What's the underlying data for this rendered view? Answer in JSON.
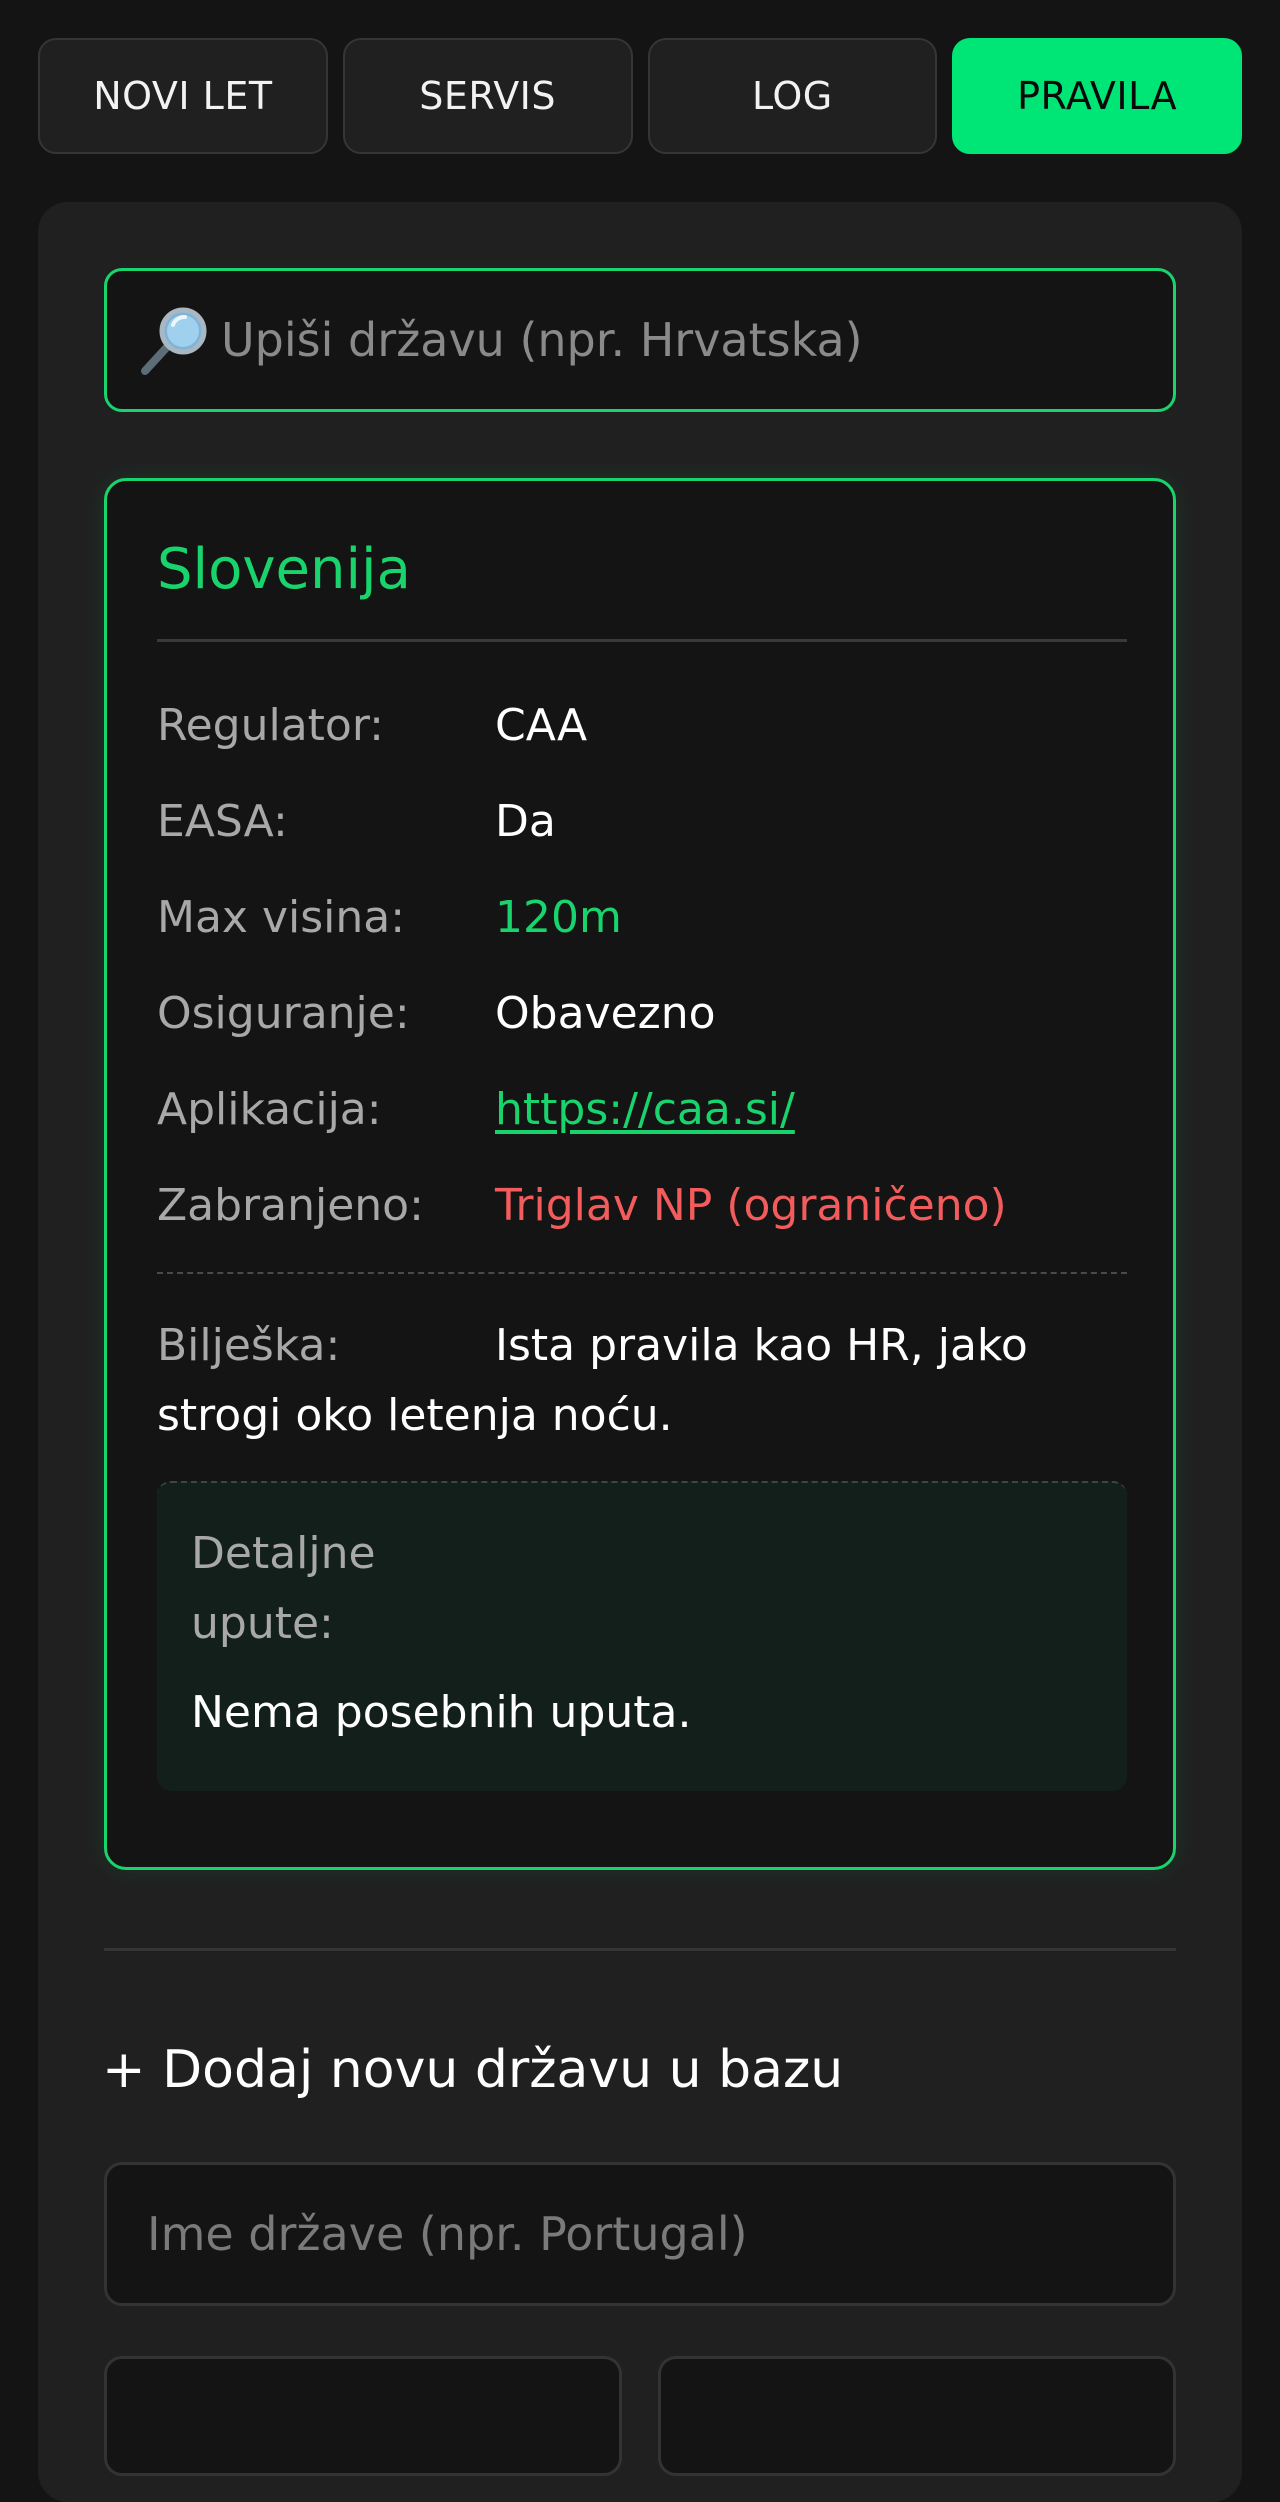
{
  "tabs": [
    {
      "label": "NOVI LET"
    },
    {
      "label": "SERVIS"
    },
    {
      "label": "LOG"
    },
    {
      "label": "PRAVILA",
      "active": true
    }
  ],
  "search": {
    "icon": "magnifier-icon",
    "placeholder": "Upiši državu (npr. Hrvatska)"
  },
  "country": {
    "name": "Slovenija",
    "rows": [
      {
        "label": "Regulator:",
        "value": "CAA"
      },
      {
        "label": "EASA:",
        "value": "Da"
      },
      {
        "label": "Max visina:",
        "value": "120m"
      },
      {
        "label": "Osiguranje:",
        "value": "Obavezno"
      },
      {
        "label": "Aplikacija:",
        "value": "https://caa.si/"
      },
      {
        "label": "Zabranjeno:",
        "value": "Triglav NP (ograničeno)"
      }
    ],
    "note_label": "Bilješka:",
    "note_text": "Ista pravila kao HR, jako strogi oko letenja noću.",
    "details_label": "Detaljne upute:",
    "details_text": "Nema posebnih uputa."
  },
  "add_country": {
    "title": "+ Dodaj novu državu u bazu",
    "name_placeholder": "Ime države (npr. Portugal)"
  },
  "colors": {
    "accent": "#00e676",
    "accent_text": "#19d46c",
    "danger": "#f25c5c",
    "background": "#141414",
    "panel": "#202020"
  }
}
